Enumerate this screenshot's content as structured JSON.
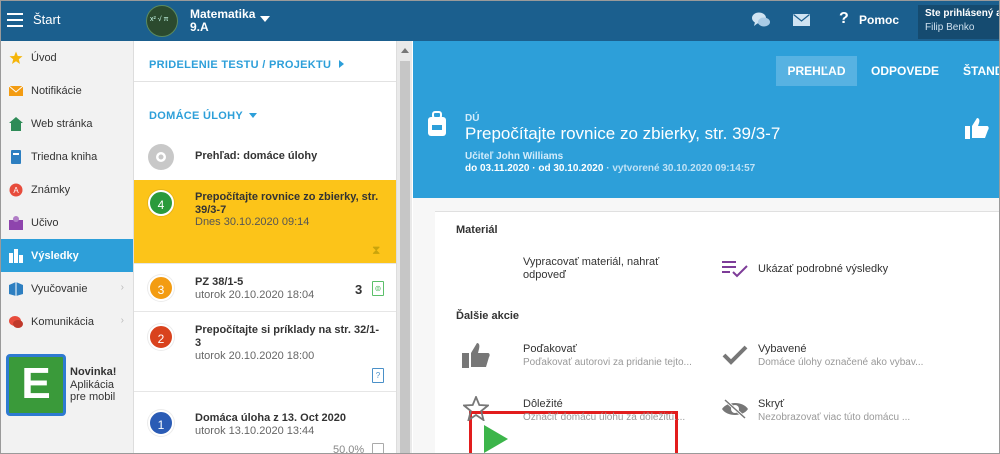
{
  "topbar": {
    "menu_label": "Štart",
    "class_name": "Matematika",
    "class_group": "9.A",
    "help_label": "Pomoc",
    "user_status": "Ste prihlásený ak",
    "user_name": "Filip Benko"
  },
  "sidebar": {
    "items": [
      {
        "label": "Úvod",
        "icon": "star-icon"
      },
      {
        "label": "Notifikácie",
        "icon": "envelope-icon"
      },
      {
        "label": "Web stránka",
        "icon": "house-icon"
      },
      {
        "label": "Triedna kniha",
        "icon": "book-icon"
      },
      {
        "label": "Známky",
        "icon": "grades-icon"
      },
      {
        "label": "Učivo",
        "icon": "learning-icon"
      },
      {
        "label": "Výsledky",
        "icon": "bar-chart-icon"
      },
      {
        "label": "Vyučovanie",
        "icon": "teaching-icon"
      },
      {
        "label": "Komunikácia",
        "icon": "chat-icon"
      }
    ],
    "promo_title": "Novinka!",
    "promo_text": "Aplikácia pre mobil",
    "promo_logo": "E"
  },
  "middle": {
    "assign_link": "PRIDELENIE TESTU / PROJEKTU",
    "filter_link": "DOMÁCE ÚLOHY",
    "overview_label": "Prehľad: domáce úlohy",
    "homework": [
      {
        "number": "4",
        "title": "Prepočítajte rovnice zo zbierky, str. 39/3-7",
        "date": "Dnes 30.10.2020 09:14",
        "color": "#2a9a3c"
      },
      {
        "number": "3",
        "title": "PZ 38/1-5",
        "date": "utorok 20.10.2020 18:04",
        "count": "3",
        "color": "#f39c12"
      },
      {
        "number": "2",
        "title": "Prepočítajte si príklady na str. 32/1-3",
        "date": "utorok 20.10.2020 18:00",
        "color": "#d9421d"
      },
      {
        "number": "1",
        "title": "Domáca úloha z 13. Oct 2020",
        "date": "utorok 13.10.2020 13:44",
        "percent": "50.0%",
        "color": "#2a5bb5"
      }
    ]
  },
  "detail": {
    "tabs": [
      "PREHĽAD",
      "ODPOVEDE",
      "ŠTAND"
    ],
    "type_label": "DÚ",
    "title": "Prepočítajte rovnice zo zbierky, str. 39/3-7",
    "teacher": "Učiteľ John Williams",
    "due": "do 03.11.2020 · od 30.10.2020",
    "created": " · vytvorené 30.10.2020 09:14:57",
    "material_header": "Materiál",
    "submit_label": "Vypracovať materiál, nahrať odpoveď",
    "results_label": "Ukázať podrobné výsledky",
    "more_header": "Ďalšie akcie",
    "actions": [
      {
        "title": "Poďakovať",
        "sub": "Poďakovať autorovi za pridanie tejto..."
      },
      {
        "title": "Vybavené",
        "sub": "Domáce úlohy označené ako vybav..."
      },
      {
        "title": "Dôležité",
        "sub": "Označiť domácu úlohu za dôležitú...."
      },
      {
        "title": "Skryť",
        "sub": "Nezobrazovať viac túto domácu ..."
      }
    ]
  },
  "colors": {
    "topbar": "#1b5f8e",
    "accent": "#2d9fd9",
    "selected": "#fcc419",
    "highlight_box": "#e21d1d",
    "play": "#3cb54a"
  }
}
